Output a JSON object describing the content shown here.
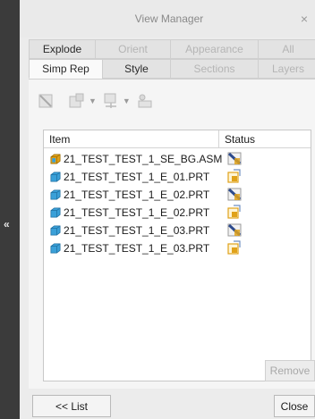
{
  "window": {
    "title": "View Manager",
    "close_glyph": "×"
  },
  "side": {
    "collapse_glyph": "«"
  },
  "tabs_row1": [
    {
      "label": "Explode",
      "enabled": true
    },
    {
      "label": "Orient",
      "enabled": false
    },
    {
      "label": "Appearance",
      "enabled": false
    },
    {
      "label": "All",
      "enabled": false
    }
  ],
  "tabs_row2": [
    {
      "label": "Simp Rep",
      "enabled": true,
      "active": true
    },
    {
      "label": "Style",
      "enabled": true
    },
    {
      "label": "Sections",
      "enabled": false
    },
    {
      "label": "Layers",
      "enabled": false
    }
  ],
  "toolbar_icons": [
    "new-rep-icon",
    "edit-rep-icon",
    "properties-icon",
    "options-icon"
  ],
  "list": {
    "columns": {
      "item": "Item",
      "status": "Status"
    },
    "rows": [
      {
        "name": "21_TEST_TEST_1_SE_BG.ASM",
        "type": "asm",
        "status": "excluded"
      },
      {
        "name": "21_TEST_TEST_1_E_01.PRT",
        "type": "prt",
        "status": "master"
      },
      {
        "name": "21_TEST_TEST_1_E_02.PRT",
        "type": "prt",
        "status": "excluded"
      },
      {
        "name": "21_TEST_TEST_1_E_02.PRT",
        "type": "prt",
        "status": "master"
      },
      {
        "name": "21_TEST_TEST_1_E_03.PRT",
        "type": "prt",
        "status": "excluded"
      },
      {
        "name": "21_TEST_TEST_1_E_03.PRT",
        "type": "prt",
        "status": "master"
      }
    ]
  },
  "buttons": {
    "remove": "Remove",
    "list": "<< List",
    "close": "Close"
  },
  "colors": {
    "part_blue": "#3aa0d8",
    "asm_gold": "#e0a21a",
    "status_navy": "#2c4a8c"
  }
}
